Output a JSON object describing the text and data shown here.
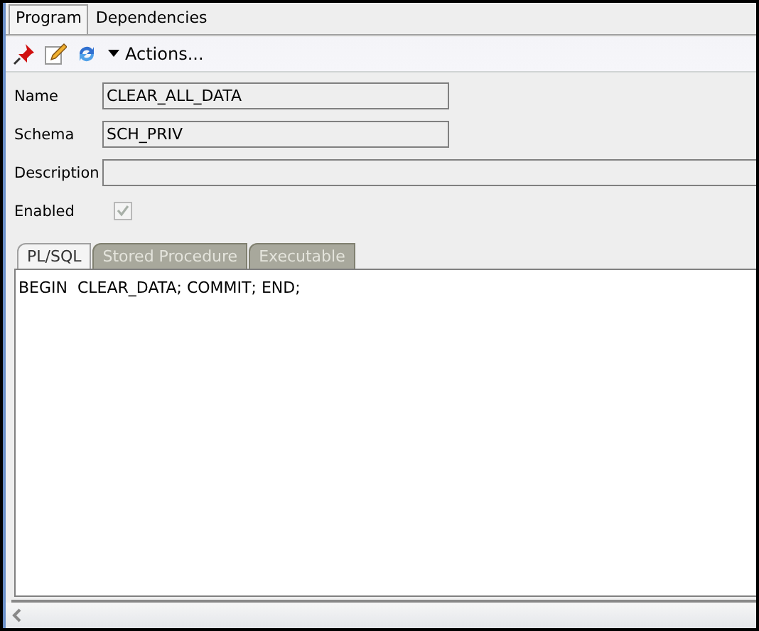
{
  "tabs": [
    {
      "label": "Program",
      "selected": true
    },
    {
      "label": "Dependencies",
      "selected": false
    }
  ],
  "toolbar": {
    "actions_label": "Actions..."
  },
  "form": [
    {
      "label": "Name",
      "value": "CLEAR_ALL_DATA",
      "kind": "short"
    },
    {
      "label": "Schema",
      "value": "SCH_PRIV",
      "kind": "short"
    },
    {
      "label": "Description",
      "kind": "wide"
    }
  ],
  "enabled": {
    "label": "Enabled",
    "checked": true,
    "disabled": true
  },
  "code_tabs": [
    {
      "label": "PL/SQL",
      "selected": true
    },
    {
      "label": "Stored Procedure",
      "selected": false
    },
    {
      "label": "Executable",
      "selected": false
    }
  ],
  "code": "BEGIN  CLEAR_DATA; COMMIT; END;"
}
